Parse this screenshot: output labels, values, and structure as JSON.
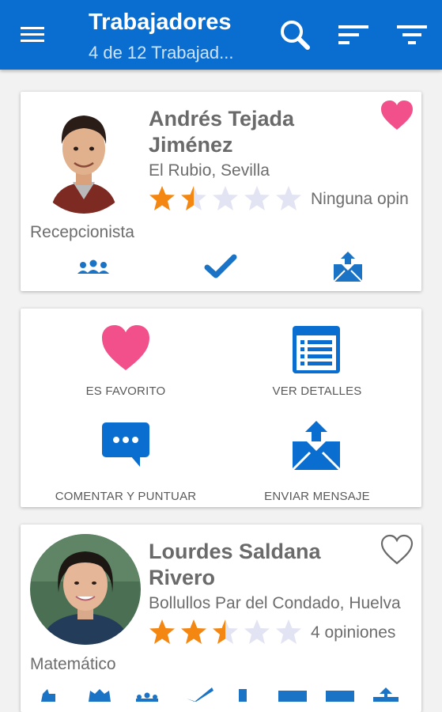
{
  "appbar": {
    "title": "Trabajadores",
    "subtitle": "4 de 12 Trabajad...",
    "icons": [
      "menu-icon",
      "search-icon",
      "sort-icon",
      "filter-icon"
    ],
    "color": "#0a6ed1"
  },
  "workers": [
    {
      "name": "Andrés Tejada Jiménez",
      "location": "El Rubio, Sevilla",
      "rating": 1.5,
      "rating_text": "Ninguna opin",
      "job": "Recepcionista",
      "favorite": true
    },
    {
      "name": "Lourdes Saldana Rivero",
      "location": "Bollullos Par del Condado, Huelva",
      "rating": 2.5,
      "rating_text": "4 opiniones",
      "job": "Matemático",
      "favorite": false
    }
  ],
  "quick_actions": {
    "favorite_label": "ES FAVORITO",
    "details_label": "VER DETALLES",
    "comment_label": "COMENTAR Y PUNTUAR",
    "message_label": "ENVIAR MENSAJE"
  },
  "colors": {
    "primary": "#0a6ed1",
    "favorite": "#f2508a",
    "star_on": "#f48712",
    "star_off": "#e3e4f3"
  }
}
